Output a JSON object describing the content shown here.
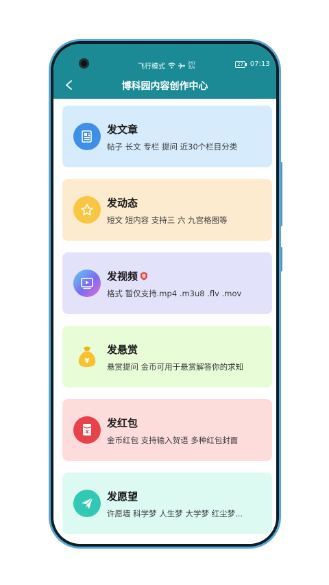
{
  "statusbar": {
    "mode_text": "飞行模式",
    "speed_value": "261",
    "speed_unit": "B/s",
    "battery": "27",
    "time": "07:13"
  },
  "header": {
    "title": "博科园内容创作中心"
  },
  "cards": [
    {
      "title": "发文章",
      "desc": "帖子 长文 专栏 提问 近30个栏目分类",
      "bg": "#d6ebfb",
      "icon": "article-icon",
      "icon_color": "#3e8fe6"
    },
    {
      "title": "发动态",
      "desc": "短文 短内容 支持三 六 九宫格图等",
      "bg": "#fdebd0",
      "icon": "star-icon",
      "icon_color": "#f8c642"
    },
    {
      "title": "发视频",
      "desc": "格式 暂仅支持.mp4 .m3u8 .flv .mov",
      "bg": "#e3e2fb",
      "icon": "video-icon",
      "icon_color": "#7b6cf2"
    },
    {
      "title": "发悬赏",
      "desc": "悬赏提问 金币可用于悬赏解答你的求知",
      "bg": "#e8fcd8",
      "icon": "money-bag-icon",
      "icon_color": "#f4b21b"
    },
    {
      "title": "发红包",
      "desc": "金币红包 支持输入贺语 多种红包封面",
      "bg": "#fddcdc",
      "icon": "red-envelope-icon",
      "icon_color": "#e8434a"
    },
    {
      "title": "发愿望",
      "desc": "许愿墙 科学梦 人生梦 大学梦 红尘梦...",
      "bg": "#ddfaf2",
      "icon": "paper-plane-icon",
      "icon_color": "#32c9b4"
    }
  ]
}
